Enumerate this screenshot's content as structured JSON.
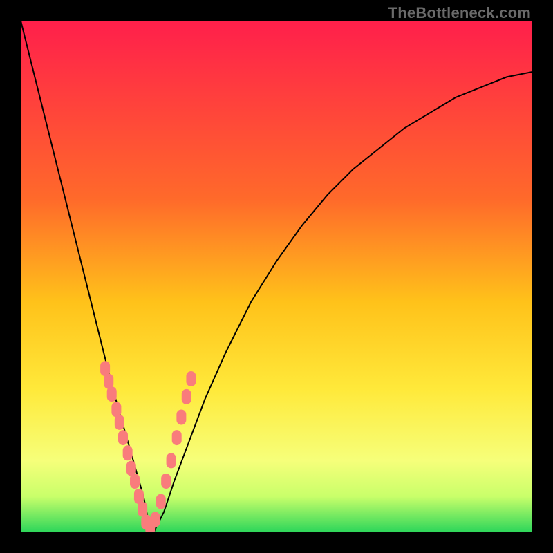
{
  "watermark": "TheBottleneck.com",
  "chart_data": {
    "type": "line",
    "title": "",
    "xlabel": "",
    "ylabel": "",
    "xlim": [
      0,
      100
    ],
    "ylim": [
      0,
      100
    ],
    "gradient_stops": [
      {
        "offset": 0,
        "color": "#ff1f4b"
      },
      {
        "offset": 35,
        "color": "#ff6a2a"
      },
      {
        "offset": 55,
        "color": "#ffc21a"
      },
      {
        "offset": 72,
        "color": "#ffe93a"
      },
      {
        "offset": 86,
        "color": "#f6ff7a"
      },
      {
        "offset": 93,
        "color": "#c9ff6a"
      },
      {
        "offset": 100,
        "color": "#2cd65a"
      }
    ],
    "series": [
      {
        "name": "bottleneck-curve",
        "x": [
          0,
          2,
          4,
          6,
          8,
          10,
          12,
          14,
          16,
          18,
          20,
          22,
          24,
          25,
          26,
          28,
          30,
          33,
          36,
          40,
          45,
          50,
          55,
          60,
          65,
          70,
          75,
          80,
          85,
          90,
          95,
          100
        ],
        "y": [
          100,
          92,
          84,
          76,
          68,
          60,
          52,
          44,
          36,
          28,
          21,
          14,
          7,
          2,
          0,
          4,
          10,
          18,
          26,
          35,
          45,
          53,
          60,
          66,
          71,
          75,
          79,
          82,
          85,
          87,
          89,
          90
        ]
      }
    ],
    "scatter_points": {
      "name": "sample-points",
      "color": "#f97c7c",
      "x": [
        16.5,
        17.2,
        17.8,
        18.7,
        19.3,
        20.0,
        20.9,
        21.6,
        22.3,
        23.1,
        23.8,
        24.5,
        25.3,
        26.3,
        27.4,
        28.4,
        29.4,
        30.5,
        31.4,
        32.4,
        33.3
      ],
      "y": [
        32.0,
        29.5,
        27.0,
        24.0,
        21.5,
        18.5,
        15.5,
        12.5,
        10.0,
        7.0,
        4.5,
        2.0,
        1.0,
        2.5,
        6.0,
        10.0,
        14.0,
        18.5,
        22.5,
        26.5,
        30.0
      ]
    }
  }
}
